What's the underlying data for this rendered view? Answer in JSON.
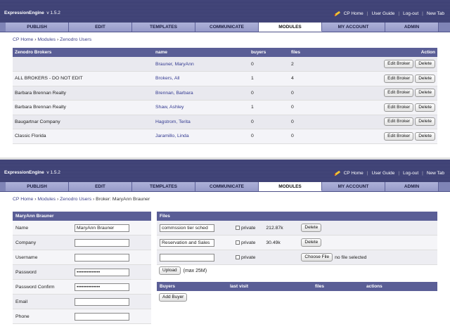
{
  "header": {
    "app_name": "ExpressionEngine",
    "version": "v 1.5.2",
    "links": [
      "CP Home",
      "User Guide",
      "Log-out",
      "New Tab"
    ]
  },
  "tabs": [
    "PUBLISH",
    "EDIT",
    "TEMPLATES",
    "COMMUNICATE",
    "MODULES",
    "MY ACCOUNT",
    "ADMIN"
  ],
  "active_tab": "MODULES",
  "top": {
    "breadcrumb": [
      "CP Home",
      "Modules",
      "Zenodro Users"
    ],
    "columns": [
      "Zenodro Brokers",
      "name",
      "buyers",
      "files",
      "Action"
    ],
    "rows": [
      {
        "broker": "",
        "name": "Brauner, MaryAnn",
        "buyers": "0",
        "files": "2"
      },
      {
        "broker": "ALL BROKERS - DO NOT EDIT",
        "name": "Brokers, All",
        "buyers": "1",
        "files": "4"
      },
      {
        "broker": "Barbara Brennan Realty",
        "name": "Brennan, Barbara",
        "buyers": "0",
        "files": "0"
      },
      {
        "broker": "Barbara Brennan Realty",
        "name": "Shaw, Ashley",
        "buyers": "1",
        "files": "0"
      },
      {
        "broker": "Baugartnar Company",
        "name": "Hagstrom, Terita",
        "buyers": "0",
        "files": "0"
      },
      {
        "broker": "Classic Florida",
        "name": "Jaramillo, Linda",
        "buyers": "0",
        "files": "0"
      }
    ],
    "edit_label": "Edit Broker",
    "delete_label": "Delete"
  },
  "bottom": {
    "breadcrumb": [
      "CP Home",
      "Modules",
      "Zenodro Users"
    ],
    "breadcrumb_current": "Broker: MaryAnn Brauner",
    "form_title": "MaryAnn Brauner",
    "fields": [
      {
        "label": "Name",
        "value": "MaryAnn Brauner"
      },
      {
        "label": "Company",
        "value": ""
      },
      {
        "label": "Username",
        "value": ""
      },
      {
        "label": "Password",
        "value": "••••••••••••••"
      },
      {
        "label": "Password Confirm",
        "value": "••••••••••••••"
      },
      {
        "label": "Email",
        "value": ""
      },
      {
        "label": "Phone",
        "value": ""
      }
    ],
    "files_title": "Files",
    "files": [
      {
        "name": "commssion tier sched",
        "private_label": "private",
        "size": "212.87k",
        "delete_label": "Delete"
      },
      {
        "name": "Reservation and Sales",
        "private_label": "private",
        "size": "30.49k",
        "delete_label": "Delete"
      }
    ],
    "new_file": {
      "private_label": "private",
      "choose_label": "Choose File",
      "no_file_text": "no file selected"
    },
    "upload_label": "Upload",
    "max_text": "(max 25M)",
    "buyers_columns": [
      "Buyers",
      "last visit",
      "files",
      "actions"
    ],
    "add_buyer_label": "Add Buyer"
  }
}
